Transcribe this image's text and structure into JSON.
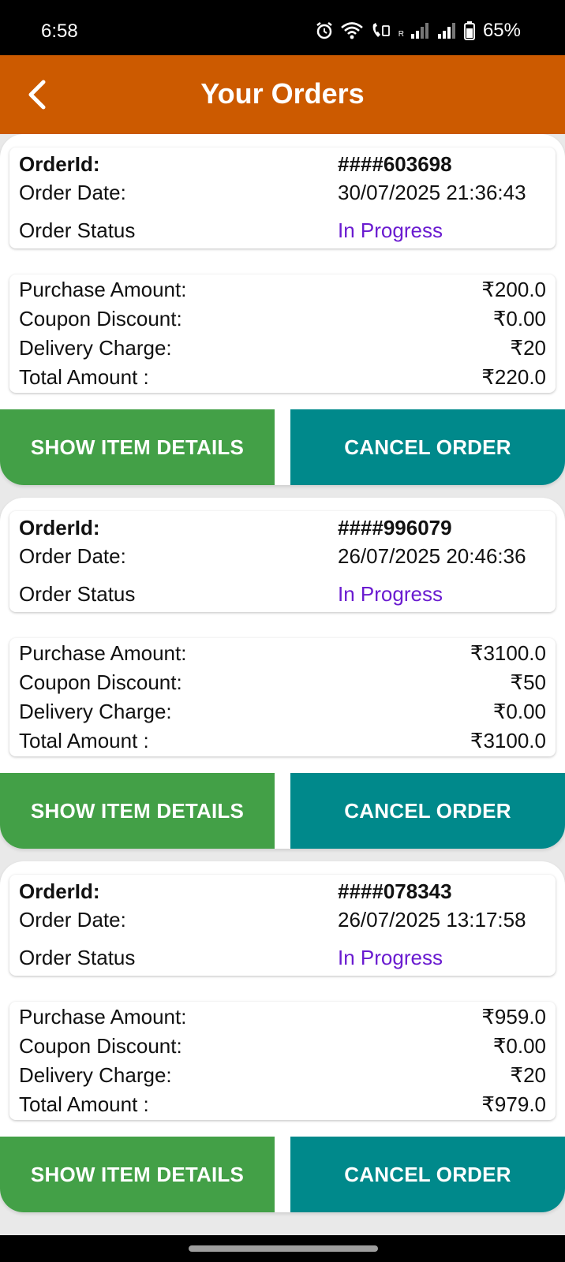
{
  "status_bar": {
    "time": "6:58",
    "battery": "65%",
    "sim_label": "R"
  },
  "header": {
    "title": "Your Orders",
    "background": "#cc5a00"
  },
  "labels": {
    "order_id": "OrderId:",
    "order_date": "Order Date:",
    "order_status": "Order Status",
    "purchase_amount": "Purchase Amount:",
    "coupon_discount": "Coupon Discount:",
    "delivery_charge": "Delivery Charge:",
    "total_amount": "Total Amount :",
    "show_details": "SHOW ITEM DETAILS",
    "cancel_order": "CANCEL ORDER"
  },
  "colors": {
    "status_text": "#6a1bd0",
    "details_button": "#43a047",
    "cancel_button": "#00898b"
  },
  "orders": [
    {
      "id": "####603698",
      "date": "30/07/2025 21:36:43",
      "status": "In Progress",
      "purchase": "₹200.0",
      "coupon": "₹0.00",
      "delivery": "₹20",
      "total": "₹220.0"
    },
    {
      "id": "####996079",
      "date": "26/07/2025 20:46:36",
      "status": "In Progress",
      "purchase": "₹3100.0",
      "coupon": "₹50",
      "delivery": "₹0.00",
      "total": "₹3100.0"
    },
    {
      "id": "####078343",
      "date": "26/07/2025 13:17:58",
      "status": "In Progress",
      "purchase": "₹959.0",
      "coupon": "₹0.00",
      "delivery": "₹20",
      "total": "₹979.0"
    }
  ]
}
